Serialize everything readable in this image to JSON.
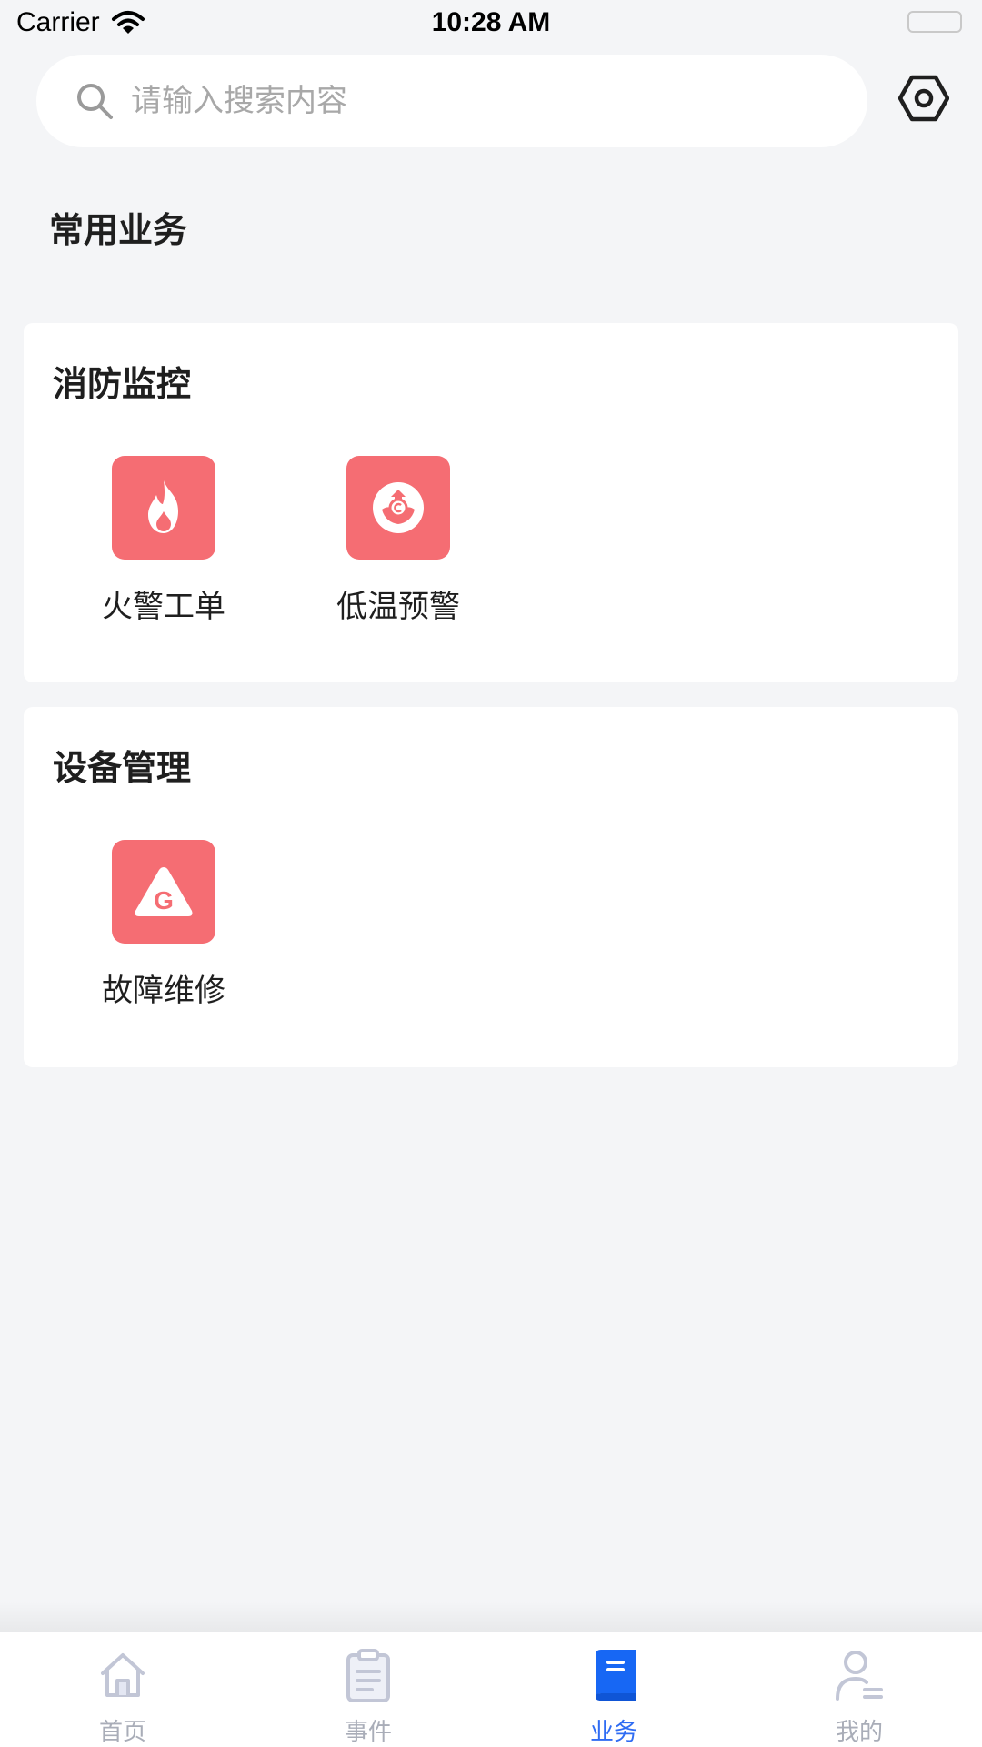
{
  "status_bar": {
    "carrier": "Carrier",
    "time": "10:28 AM"
  },
  "search": {
    "placeholder": "请输入搜索内容",
    "value": ""
  },
  "section_title": "常用业务",
  "cards": [
    {
      "title": "消防监控",
      "items": [
        {
          "label": "火警工单",
          "icon": "flame-icon"
        },
        {
          "label": "低温预警",
          "icon": "low-temp-warning-icon"
        }
      ]
    },
    {
      "title": "设备管理",
      "items": [
        {
          "label": "故障维修",
          "icon": "warning-triangle-g-icon"
        }
      ]
    }
  ],
  "tabbar": {
    "tabs": [
      {
        "label": "首页",
        "icon": "home-icon",
        "active": false
      },
      {
        "label": "事件",
        "icon": "clipboard-icon",
        "active": false
      },
      {
        "label": "业务",
        "icon": "book-icon",
        "active": true
      },
      {
        "label": "我的",
        "icon": "user-icon",
        "active": false
      }
    ]
  },
  "colors": {
    "tile_background": "#f56d73",
    "active_tab": "#2f6cf3",
    "inactive_tab": "#a9adb8",
    "page_background": "#f4f5f7"
  }
}
